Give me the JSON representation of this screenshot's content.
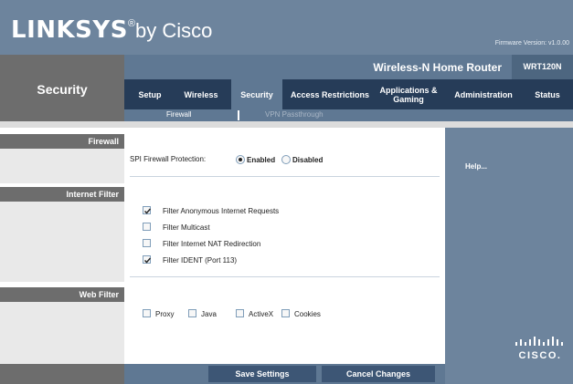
{
  "header": {
    "brand": "LINKSYS",
    "registered": "®",
    "by": "by Cisco",
    "firmware": "Firmware Version: v1.0.00"
  },
  "section_title": "Security",
  "product_name": "Wireless-N Home Router",
  "model": "WRT120N",
  "nav": {
    "tabs": [
      {
        "label": "Setup"
      },
      {
        "label": "Wireless"
      },
      {
        "label": "Security"
      },
      {
        "label": "Access Restrictions"
      },
      {
        "label": "Applications &\nGaming"
      },
      {
        "label": "Administration"
      },
      {
        "label": "Status"
      }
    ],
    "active": "Security"
  },
  "subnav": {
    "items": [
      {
        "label": "Firewall"
      },
      {
        "label": "VPN Passthrough"
      }
    ]
  },
  "left": {
    "firewall": "Firewall",
    "internet_filter": "Internet Filter",
    "web_filter": "Web Filter"
  },
  "firewall": {
    "spi_label": "SPI Firewall Protection:",
    "enabled_label": "Enabled",
    "disabled_label": "Disabled",
    "selected": "Enabled"
  },
  "internet_filter": {
    "items": [
      {
        "label": "Filter Anonymous Internet Requests",
        "checked": true
      },
      {
        "label": "Filter Multicast",
        "checked": false
      },
      {
        "label": "Filter Internet NAT Redirection",
        "checked": false
      },
      {
        "label": "Filter IDENT (Port 113)",
        "checked": true
      }
    ]
  },
  "web_filter": {
    "items": [
      {
        "label": "Proxy",
        "checked": false
      },
      {
        "label": "Java",
        "checked": false
      },
      {
        "label": "ActiveX",
        "checked": false
      },
      {
        "label": "Cookies",
        "checked": false
      }
    ]
  },
  "help": {
    "label": "Help..."
  },
  "actions": {
    "save": "Save Settings",
    "cancel": "Cancel Changes"
  },
  "colors": {
    "header_blue": "#6d849d",
    "nav_dark": "#263c58",
    "nav_active": "#5f7893",
    "left_gray": "#6d6d6d"
  }
}
